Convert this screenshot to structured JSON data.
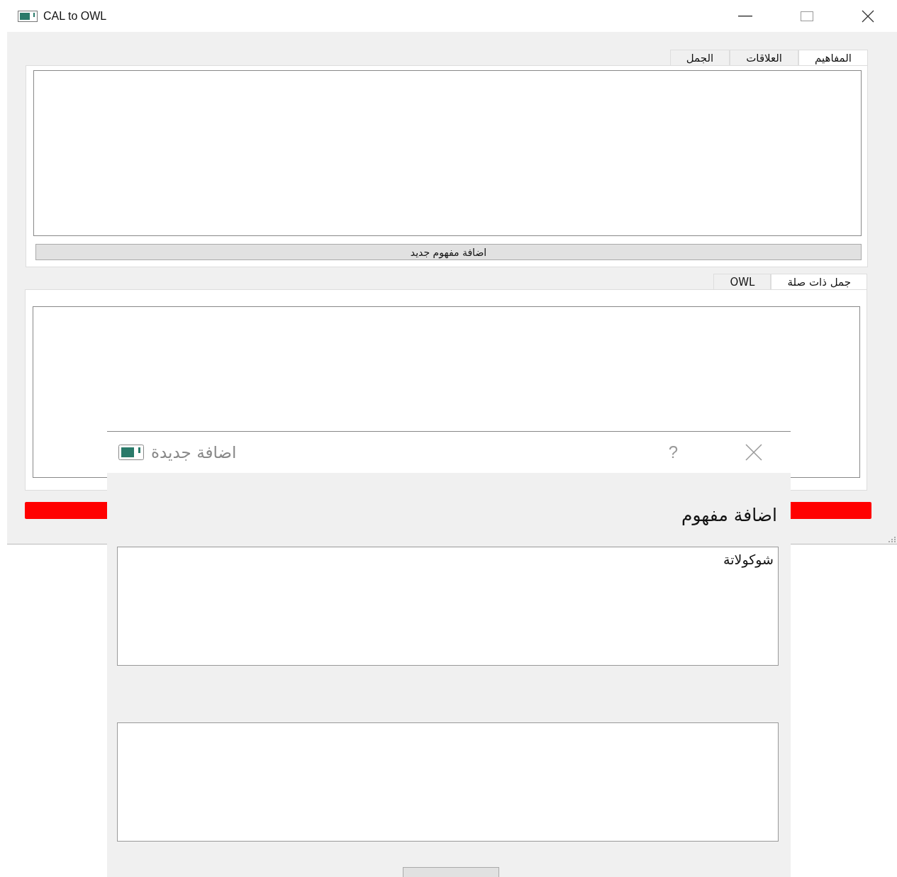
{
  "window": {
    "title": "CAL to OWL"
  },
  "concepts_panel": {
    "tabs": [
      {
        "label": "المفاهيم",
        "selected": true
      },
      {
        "label": "العلاقات",
        "selected": false
      },
      {
        "label": "الجمل",
        "selected": false
      }
    ],
    "button": "اضافة مفهوم جديد"
  },
  "output_panel": {
    "tabs": [
      {
        "label": "جمل ذات صلة",
        "selected": true
      },
      {
        "label": "OWL",
        "selected": false
      }
    ]
  },
  "dialog": {
    "title": "اضافة جديدة",
    "help": "?",
    "heading": "اضافة مفهوم",
    "name_field": {
      "value": "شوكولاتة"
    }
  }
}
